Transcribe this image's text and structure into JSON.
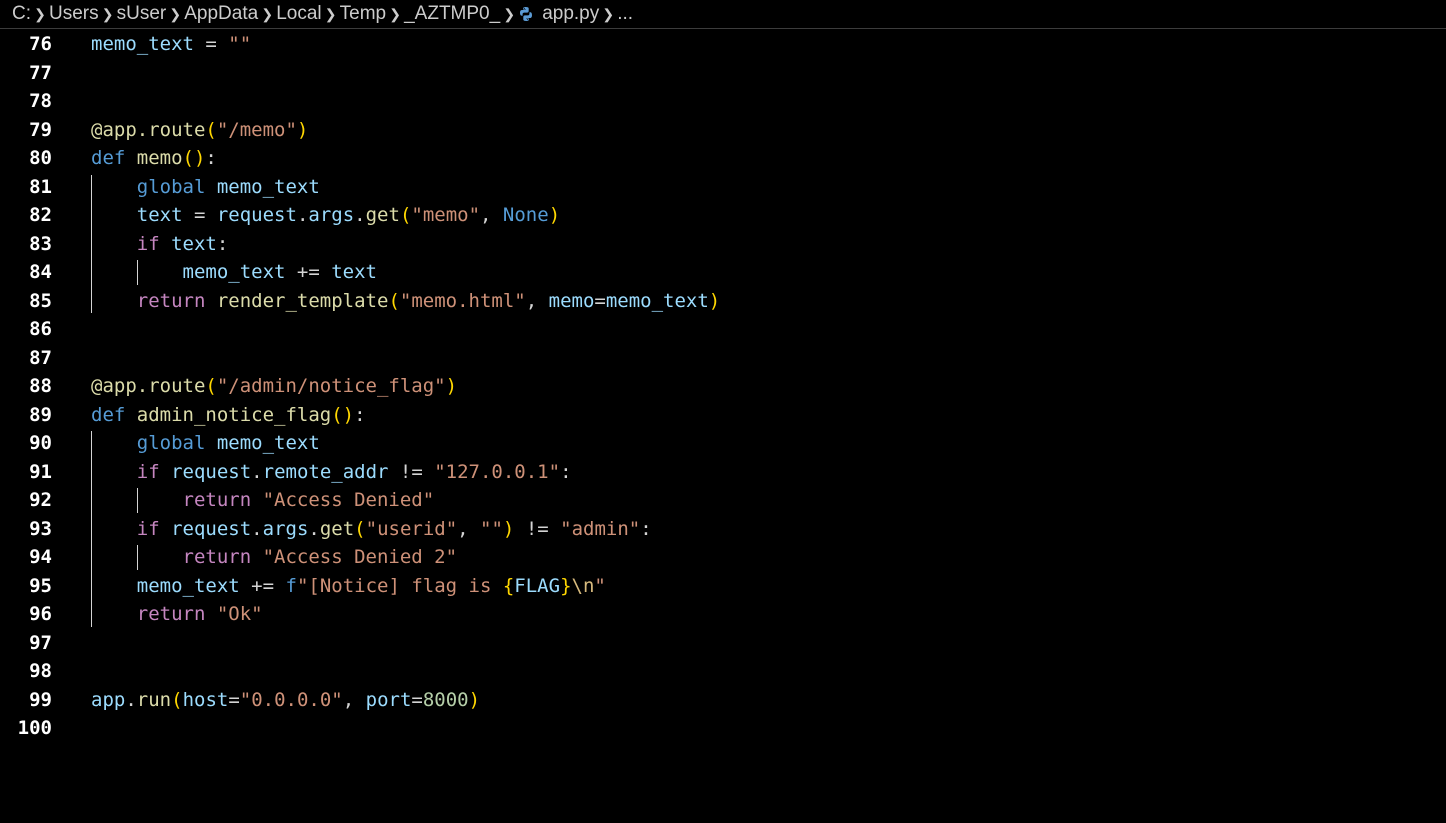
{
  "breadcrumb": {
    "items": [
      "C:",
      "Users",
      "sUser",
      "AppData",
      "Local",
      "Temp",
      "_AZTMP0_",
      "app.py",
      "..."
    ],
    "file_icon": "python-icon"
  },
  "theme": {
    "background": "#000000",
    "keyword": "#569cd6",
    "control": "#c586c0",
    "function": "#dcdcaa",
    "variable": "#9cdcfe",
    "string": "#ce9178",
    "number": "#b5cea8",
    "bracket": "#ffd700"
  },
  "editor": {
    "lines": [
      {
        "n": "76",
        "tokens": [
          [
            "memo_text",
            "var"
          ],
          [
            " = ",
            "op"
          ],
          [
            "\"\"",
            "str"
          ]
        ]
      },
      {
        "n": "77",
        "tokens": []
      },
      {
        "n": "78",
        "tokens": []
      },
      {
        "n": "79",
        "tokens": [
          [
            "@app.route",
            "dec"
          ],
          [
            "(",
            "br1"
          ],
          [
            "\"/memo\"",
            "str"
          ],
          [
            ")",
            "br1"
          ]
        ]
      },
      {
        "n": "80",
        "tokens": [
          [
            "def ",
            "kw"
          ],
          [
            "memo",
            "fn"
          ],
          [
            "()",
            "br1"
          ],
          [
            ":",
            "op"
          ]
        ]
      },
      {
        "n": "81",
        "tokens": [
          [
            "    ",
            "op"
          ],
          [
            "global ",
            "kw"
          ],
          [
            "memo_text",
            "var"
          ]
        ]
      },
      {
        "n": "82",
        "tokens": [
          [
            "    ",
            "op"
          ],
          [
            "text",
            "var"
          ],
          [
            " = ",
            "op"
          ],
          [
            "request",
            "var"
          ],
          [
            ".",
            "op"
          ],
          [
            "args",
            "var"
          ],
          [
            ".",
            "op"
          ],
          [
            "get",
            "fn"
          ],
          [
            "(",
            "br1"
          ],
          [
            "\"memo\"",
            "str"
          ],
          [
            ", ",
            "op"
          ],
          [
            "None",
            "kw"
          ],
          [
            ")",
            "br1"
          ]
        ]
      },
      {
        "n": "83",
        "tokens": [
          [
            "    ",
            "op"
          ],
          [
            "if ",
            "ctl"
          ],
          [
            "text",
            "var"
          ],
          [
            ":",
            "op"
          ]
        ]
      },
      {
        "n": "84",
        "tokens": [
          [
            "        ",
            "op"
          ],
          [
            "memo_text",
            "var"
          ],
          [
            " += ",
            "op"
          ],
          [
            "text",
            "var"
          ]
        ]
      },
      {
        "n": "85",
        "tokens": [
          [
            "    ",
            "op"
          ],
          [
            "return ",
            "ctl"
          ],
          [
            "render_template",
            "fn"
          ],
          [
            "(",
            "br1"
          ],
          [
            "\"memo.html\"",
            "str"
          ],
          [
            ", ",
            "op"
          ],
          [
            "memo",
            "var"
          ],
          [
            "=",
            "op"
          ],
          [
            "memo_text",
            "var"
          ],
          [
            ")",
            "br1"
          ]
        ]
      },
      {
        "n": "86",
        "tokens": []
      },
      {
        "n": "87",
        "tokens": []
      },
      {
        "n": "88",
        "tokens": [
          [
            "@app.route",
            "dec"
          ],
          [
            "(",
            "br1"
          ],
          [
            "\"/admin/notice_flag\"",
            "str"
          ],
          [
            ")",
            "br1"
          ]
        ]
      },
      {
        "n": "89",
        "tokens": [
          [
            "def ",
            "kw"
          ],
          [
            "admin_notice_flag",
            "fn"
          ],
          [
            "()",
            "br1"
          ],
          [
            ":",
            "op"
          ]
        ]
      },
      {
        "n": "90",
        "tokens": [
          [
            "    ",
            "op"
          ],
          [
            "global ",
            "kw"
          ],
          [
            "memo_text",
            "var"
          ]
        ]
      },
      {
        "n": "91",
        "tokens": [
          [
            "    ",
            "op"
          ],
          [
            "if ",
            "ctl"
          ],
          [
            "request",
            "var"
          ],
          [
            ".",
            "op"
          ],
          [
            "remote_addr",
            "var"
          ],
          [
            " != ",
            "op"
          ],
          [
            "\"127.0.0.1\"",
            "str"
          ],
          [
            ":",
            "op"
          ]
        ]
      },
      {
        "n": "92",
        "tokens": [
          [
            "        ",
            "op"
          ],
          [
            "return ",
            "ctl"
          ],
          [
            "\"Access Denied\"",
            "str"
          ]
        ]
      },
      {
        "n": "93",
        "tokens": [
          [
            "    ",
            "op"
          ],
          [
            "if ",
            "ctl"
          ],
          [
            "request",
            "var"
          ],
          [
            ".",
            "op"
          ],
          [
            "args",
            "var"
          ],
          [
            ".",
            "op"
          ],
          [
            "get",
            "fn"
          ],
          [
            "(",
            "br1"
          ],
          [
            "\"userid\"",
            "str"
          ],
          [
            ", ",
            "op"
          ],
          [
            "\"\"",
            "str"
          ],
          [
            ")",
            "br1"
          ],
          [
            " != ",
            "op"
          ],
          [
            "\"admin\"",
            "str"
          ],
          [
            ":",
            "op"
          ]
        ]
      },
      {
        "n": "94",
        "tokens": [
          [
            "        ",
            "op"
          ],
          [
            "return ",
            "ctl"
          ],
          [
            "\"Access Denied 2\"",
            "str"
          ]
        ]
      },
      {
        "n": "95",
        "tokens": [
          [
            "    ",
            "op"
          ],
          [
            "memo_text",
            "var"
          ],
          [
            " += ",
            "op"
          ],
          [
            "f",
            "fx"
          ],
          [
            "\"[Notice] flag is ",
            "str"
          ],
          [
            "{",
            "br1"
          ],
          [
            "FLAG",
            "var"
          ],
          [
            "}",
            "br1"
          ],
          [
            "\\n",
            "esc"
          ],
          [
            "\"",
            "str"
          ]
        ]
      },
      {
        "n": "96",
        "tokens": [
          [
            "    ",
            "op"
          ],
          [
            "return ",
            "ctl"
          ],
          [
            "\"Ok\"",
            "str"
          ]
        ]
      },
      {
        "n": "97",
        "tokens": []
      },
      {
        "n": "98",
        "tokens": []
      },
      {
        "n": "99",
        "tokens": [
          [
            "app",
            "var"
          ],
          [
            ".",
            "op"
          ],
          [
            "run",
            "fn"
          ],
          [
            "(",
            "br1"
          ],
          [
            "host",
            "var"
          ],
          [
            "=",
            "op"
          ],
          [
            "\"0.0.0.0\"",
            "str"
          ],
          [
            ", ",
            "op"
          ],
          [
            "port",
            "var"
          ],
          [
            "=",
            "op"
          ],
          [
            "8000",
            "num"
          ],
          [
            ")",
            "br1"
          ]
        ]
      },
      {
        "n": "100",
        "tokens": []
      }
    ]
  }
}
